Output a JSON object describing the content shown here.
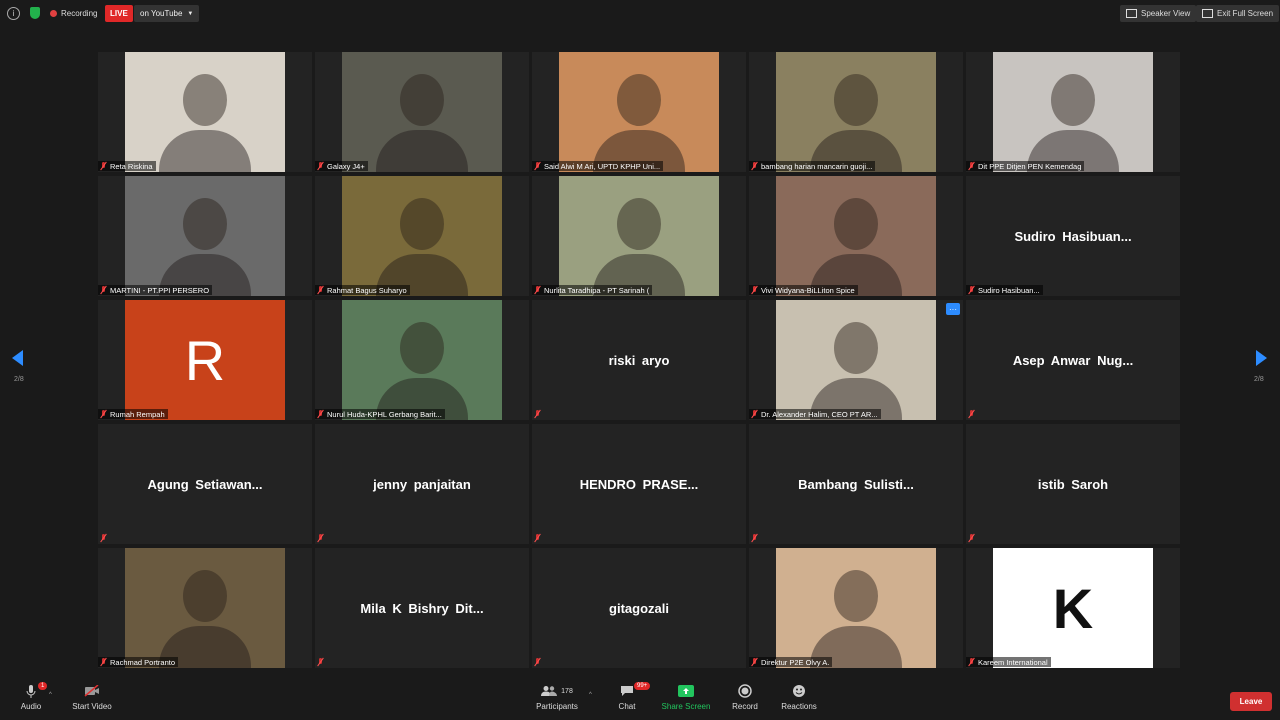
{
  "topbar": {
    "recording_label": "Recording",
    "live_label": "LIVE",
    "youtube_label": "on YouTube",
    "speaker_view_label": "Speaker View",
    "exit_fullscreen_label": "Exit Full Screen"
  },
  "pager": {
    "left_page": "2/8",
    "right_page": "2/8"
  },
  "participants": [
    {
      "name": "Reta Riskina",
      "video": true,
      "bg": "#d8d2c8"
    },
    {
      "name": "Galaxy J4+",
      "video": true,
      "bg": "#5a5a50"
    },
    {
      "name": "Said Alwi M Ari, UPTD KPHP Uni...",
      "video": true,
      "bg": "#c88a5a"
    },
    {
      "name": "bambang harian mancarin guoji...",
      "video": true,
      "bg": "#8a8060"
    },
    {
      "name": "Dit PPE Ditjen PEN Kemendag",
      "video": true,
      "bg": "#c8c4c0"
    },
    {
      "name": "MARTINI - PT.PPI PERSERO",
      "video": true,
      "bg": "#6a6a6a"
    },
    {
      "name": "Rahmat Bagus Suharyo",
      "video": true,
      "bg": "#7a6a3a"
    },
    {
      "name": "Nurlita Taradhipa - PT Sarinah (",
      "video": true,
      "bg": "#9aa080"
    },
    {
      "name": "Vivi Widyana-BiLLiton Spice",
      "video": true,
      "bg": "#8a6a5a"
    },
    {
      "name": "Sudiro  Hasibuan...",
      "video": false,
      "big": "Sudiro  Hasibuan..."
    },
    {
      "name": "Rumah Rempah",
      "video": true,
      "bg": "#c8421a",
      "letter": "R"
    },
    {
      "name": "Nurul Huda-KPHL Gerbang Barit...",
      "video": true,
      "bg": "#5a7a5a"
    },
    {
      "name": "",
      "video": false,
      "big": "riski aryo"
    },
    {
      "name": "Dr. Alexander Halim, CEO PT AR...",
      "video": true,
      "bg": "#c8c0b0",
      "more": true
    },
    {
      "name": "",
      "video": false,
      "big": "Asep  Anwar  Nug..."
    },
    {
      "name": "",
      "video": false,
      "big": "Agung  Setiawan..."
    },
    {
      "name": "",
      "video": false,
      "big": "jenny panjaitan"
    },
    {
      "name": "",
      "video": false,
      "big": "HENDRO  PRASE..."
    },
    {
      "name": "",
      "video": false,
      "big": "Bambang  Sulisti..."
    },
    {
      "name": "",
      "video": false,
      "big": "istib Saroh"
    },
    {
      "name": "Rachmad Portranto",
      "video": true,
      "bg": "#6a5a40"
    },
    {
      "name": "",
      "video": false,
      "big": "Mila K Bishry Dit..."
    },
    {
      "name": "",
      "video": false,
      "big": "gitagozali"
    },
    {
      "name": "Direktur P2E Olvy A.",
      "video": true,
      "bg": "#d0b090"
    },
    {
      "name": "Kareem International",
      "video": true,
      "bg": "#ffffff",
      "letter": "K",
      "letter_color": "#111111"
    }
  ],
  "bottombar": {
    "audio_label": "Audio",
    "audio_badge": "1",
    "start_video_label": "Start Video",
    "participants_label": "Participants",
    "participants_count": "178",
    "chat_label": "Chat",
    "chat_badge": "99+",
    "share_screen_label": "Share Screen",
    "record_label": "Record",
    "reactions_label": "Reactions",
    "leave_label": "Leave"
  },
  "colors": {
    "accent": "#2d8cff",
    "share": "#22c55e",
    "danger": "#d03030"
  }
}
